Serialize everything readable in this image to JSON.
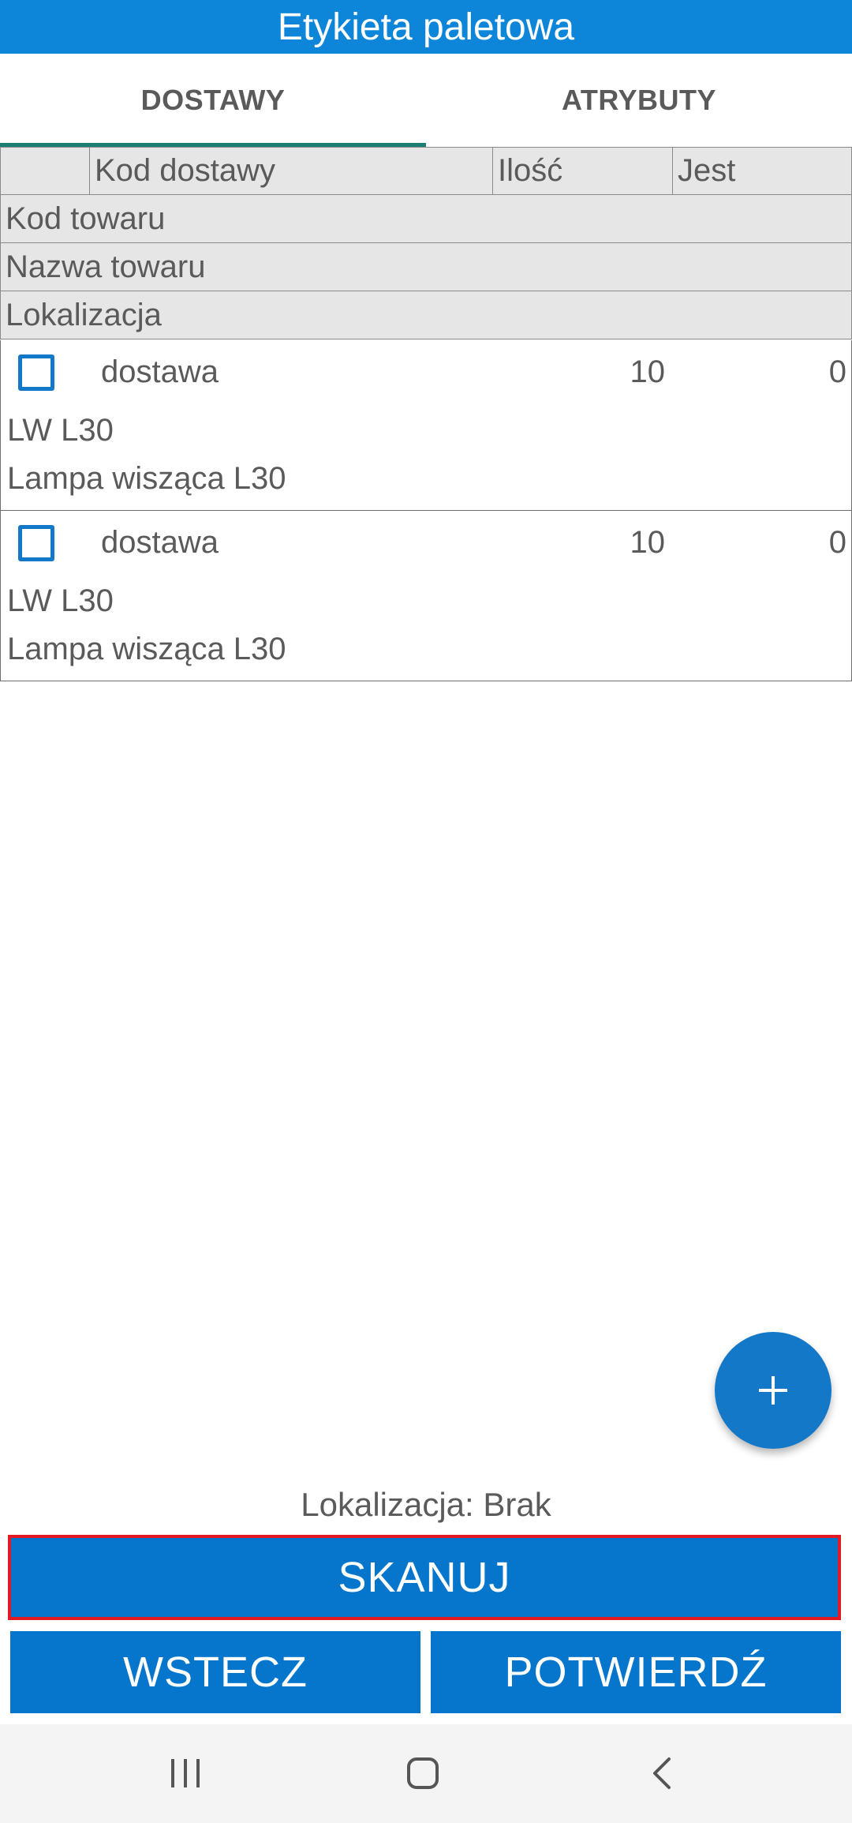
{
  "app": {
    "title": "Etykieta paletowa"
  },
  "tabs": [
    {
      "label": "DOSTAWY",
      "active": true
    },
    {
      "label": "ATRYBUTY",
      "active": false
    }
  ],
  "grid": {
    "columns": [
      "",
      "Kod dostawy",
      "Ilość",
      "Jest"
    ],
    "subheaders": [
      "Kod towaru",
      "Nazwa towaru",
      "Lokalizacja"
    ]
  },
  "items": [
    {
      "checked": false,
      "kod_dostawy": "dostawa",
      "ilosc": "10",
      "jest": "0",
      "kod_towaru": "LW L30",
      "nazwa_towaru": "Lampa wisząca L30"
    },
    {
      "checked": false,
      "kod_dostawy": "dostawa",
      "ilosc": "10",
      "jest": "0",
      "kod_towaru": "LW L30",
      "nazwa_towaru": "Lampa wisząca L30"
    }
  ],
  "fab": {
    "icon": "plus-icon"
  },
  "status": {
    "lokalizacja": "Lokalizacja: Brak"
  },
  "buttons": {
    "scan": "SKANUJ",
    "back": "WSTECZ",
    "confirm": "POTWIERDŹ"
  },
  "navbar": {
    "icons": [
      "recent-apps-icon",
      "home-icon",
      "back-icon"
    ]
  },
  "colors": {
    "primary": "#0d86da",
    "button": "#0576cc",
    "tab_indicator": "#1b7f72",
    "highlight_border": "#e31a24"
  }
}
